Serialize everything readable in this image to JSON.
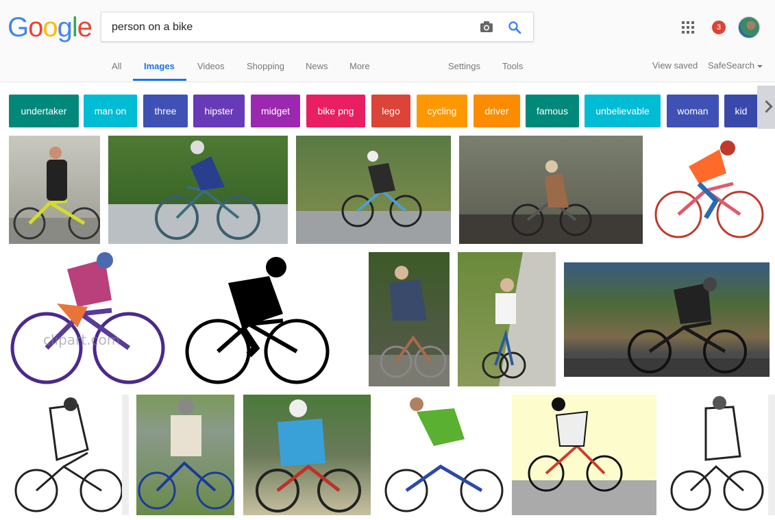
{
  "logo": {
    "letters": [
      "G",
      "o",
      "o",
      "g",
      "l",
      "e"
    ],
    "colors": [
      "#4285f4",
      "#ea4335",
      "#fbbc05",
      "#4285f4",
      "#34a853",
      "#ea4335"
    ]
  },
  "search": {
    "query": "person on a bike"
  },
  "notifications": {
    "count": "3"
  },
  "tabs": {
    "all": "All",
    "images": "Images",
    "videos": "Videos",
    "shopping": "Shopping",
    "news": "News",
    "more": "More",
    "settings": "Settings",
    "tools": "Tools",
    "view_saved": "View saved",
    "safesearch": "SafeSearch"
  },
  "chips": [
    {
      "label": "undertaker",
      "color": "#00897b"
    },
    {
      "label": "man on",
      "color": "#00bcd4"
    },
    {
      "label": "three",
      "color": "#3f51b5"
    },
    {
      "label": "hipster",
      "color": "#673ab7"
    },
    {
      "label": "midget",
      "color": "#9c27b0"
    },
    {
      "label": "bike png",
      "color": "#e91e63"
    },
    {
      "label": "lego",
      "color": "#db4437"
    },
    {
      "label": "cycling",
      "color": "#ff9800"
    },
    {
      "label": "driver",
      "color": "#fb8c00"
    },
    {
      "label": "famous",
      "color": "#00897b"
    },
    {
      "label": "unbelievable",
      "color": "#00bcd4"
    },
    {
      "label": "woman",
      "color": "#3f51b5"
    },
    {
      "label": "kid",
      "color": "#3949ab"
    }
  ],
  "watermark": "clipart.com"
}
